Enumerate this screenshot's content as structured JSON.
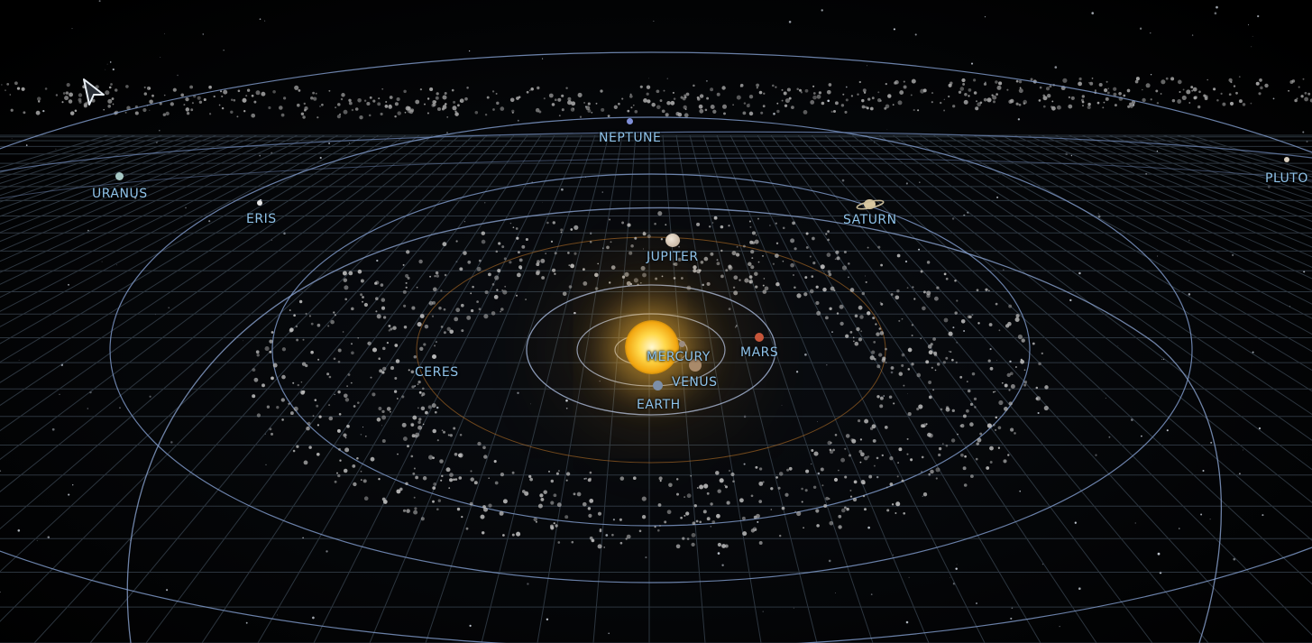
{
  "scene": {
    "type": "solar-system-3d-view",
    "colors": {
      "background": "#000000",
      "grid": "#3a4652",
      "orbit": "#7d97c6",
      "label": "#8fc3ea",
      "sun_glow": "#ffd84a",
      "asteroid": "#a8a8a8"
    }
  },
  "labels": {
    "neptune": "NEPTUNE",
    "uranus": "URANUS",
    "eris": "ERIS",
    "saturn": "SATURN",
    "pluto": "PLUTO",
    "jupiter": "JUPITER",
    "mars": "MARS",
    "ceres": "CERES",
    "mercury": "MERCURY",
    "venus": "VENUS",
    "earth": "EARTH"
  },
  "icons": {
    "cursor": "arrow-cursor-icon"
  }
}
